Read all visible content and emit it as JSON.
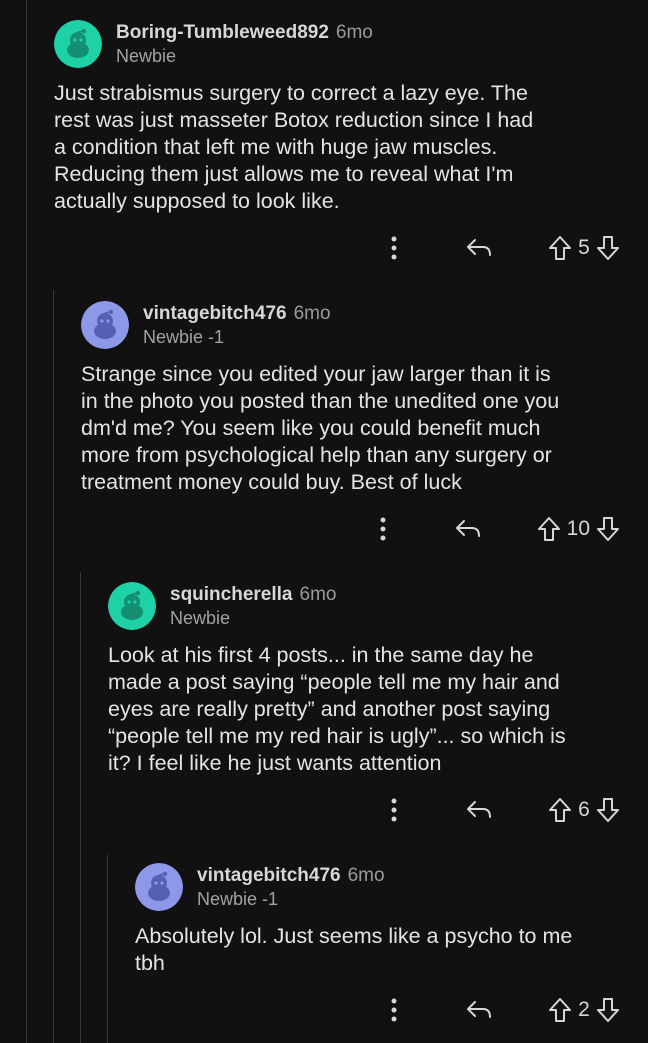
{
  "comments": [
    {
      "author": "Boring-Tumbleweed892",
      "age": "6mo",
      "flair": "Newbie",
      "body": "Just strabismus surgery to correct a lazy eye. The\nrest was just masseter Botox reduction since I had\na condition that left me with huge jaw muscles.\nReducing them just allows me to reveal what I'm\nactually supposed to look like.",
      "votes": "5",
      "avatar_color": "#1fd1a6"
    },
    {
      "author": "vintagebitch476",
      "age": "6mo",
      "flair": "Newbie -1",
      "body": "Strange since you edited your jaw larger than it is\nin the photo you posted than the unedited one you\ndm'd me? You seem like you could benefit much\nmore from psychological help than any surgery or\ntreatment money could buy. Best of luck",
      "votes": "10",
      "avatar_color": "#8e98e8"
    },
    {
      "author": "squincherella",
      "age": "6mo",
      "flair": "Newbie",
      "body": "Look at his first 4 posts... in the same day he\nmade a post saying “people tell me my hair and\neyes are really pretty” and another post saying\n“people tell me my red hair is ugly”... so which is\nit? I feel like he just wants attention",
      "votes": "6",
      "avatar_color": "#1fd1a6"
    },
    {
      "author": "vintagebitch476",
      "age": "6mo",
      "flair": "Newbie -1",
      "body": "Absolutely lol. Just seems like a psycho to me\ntbh",
      "votes": "2",
      "avatar_color": "#8e98e8"
    }
  ],
  "icons": {
    "more": "more-vertical-icon",
    "reply": "reply-arrow-icon",
    "upvote": "upvote-arrow-icon",
    "downvote": "downvote-arrow-icon"
  },
  "colors": {
    "background": "#111111",
    "thread_line": "#3a3a3a",
    "text": "#e4e4e4",
    "meta": "#9a9a9a"
  }
}
